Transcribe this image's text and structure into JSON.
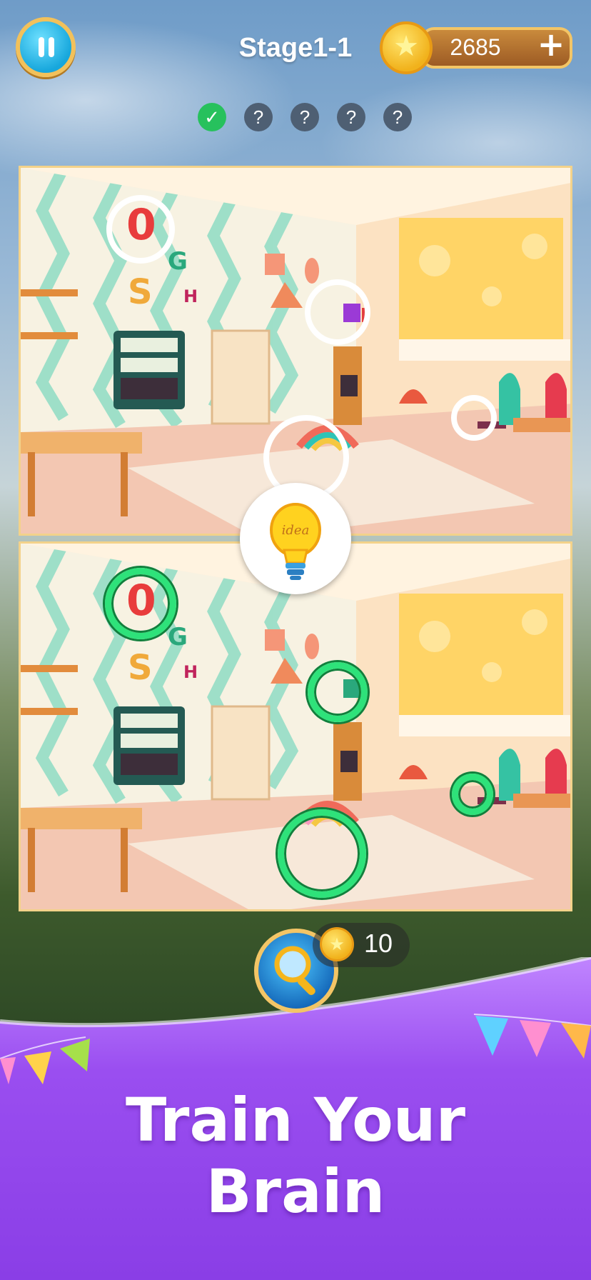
{
  "header": {
    "stage_title": "Stage1-1",
    "coin_balance": "2685",
    "add_coins_symbol": "+"
  },
  "progress": {
    "found_count": 1,
    "total": 5,
    "found_symbol": "✓",
    "unknown_symbol": "?"
  },
  "hint": {
    "bulb_label": "idea"
  },
  "magnifier": {
    "cost": "10"
  },
  "banner": {
    "line1": "Train Your",
    "line2": "Brain"
  },
  "colors": {
    "found_ring": "#2ee27a",
    "target_ring": "#ffffff",
    "banner_purple": "#8f46e6"
  }
}
